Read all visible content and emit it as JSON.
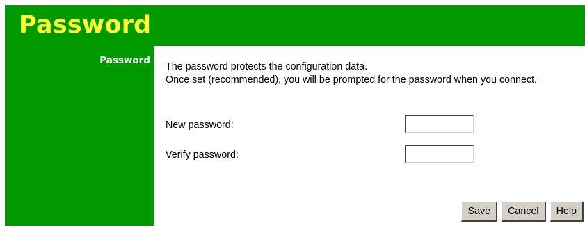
{
  "header": {
    "title": "Password"
  },
  "sidebar": {
    "label": "Password"
  },
  "main": {
    "description": [
      "The password protects the configuration data.",
      "Once set (recommended), you will be prompted for the password when you connect."
    ],
    "new_password": {
      "label": "New password:",
      "value": ""
    },
    "verify_password": {
      "label": "Verify password:",
      "value": ""
    }
  },
  "buttons": {
    "save": "Save",
    "cancel": "Cancel",
    "help": "Help"
  },
  "colors": {
    "brand_green": "#009900",
    "title_yellow": "#ffff33",
    "button_face": "#d4d0c8"
  }
}
